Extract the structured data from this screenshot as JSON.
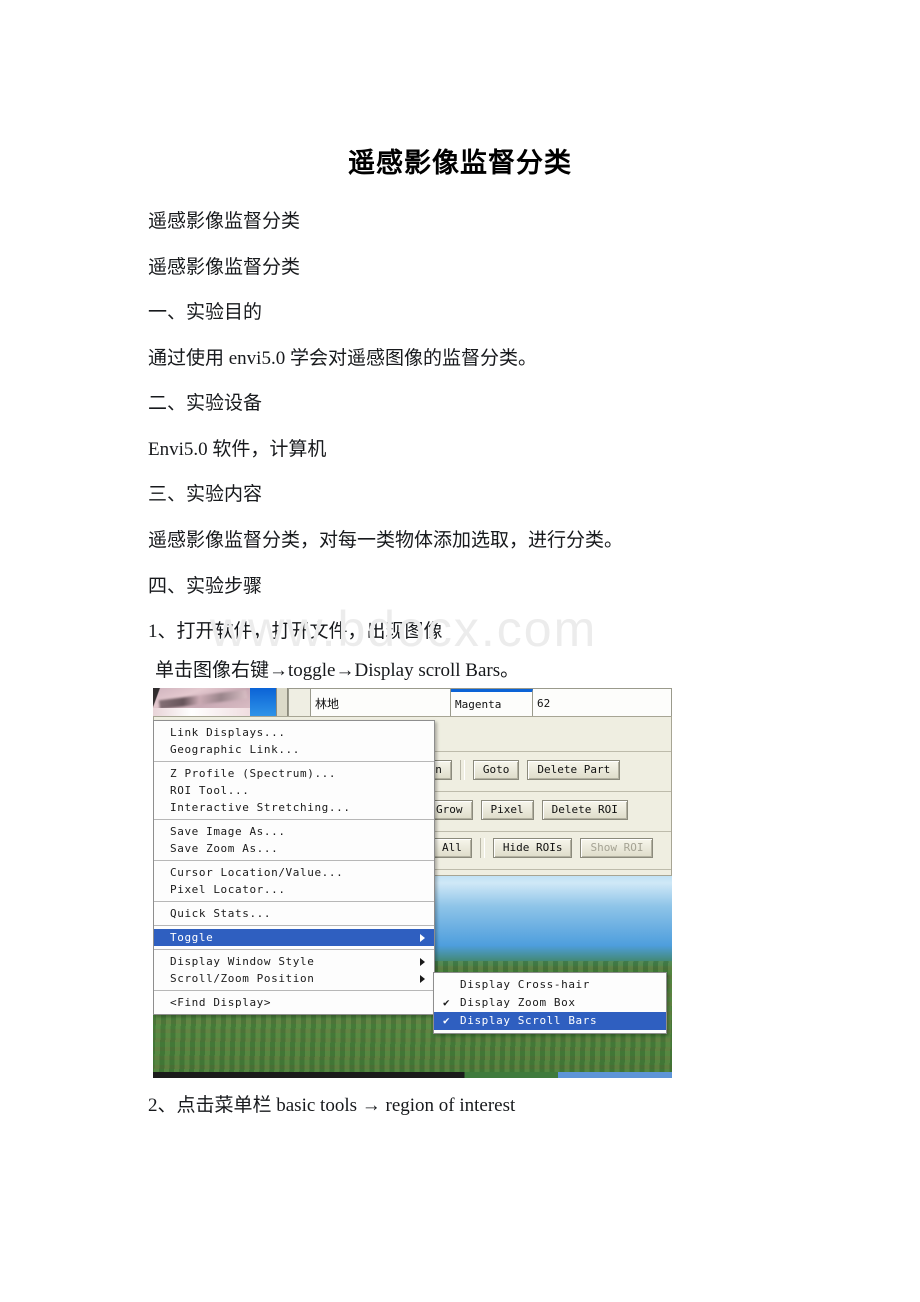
{
  "document": {
    "title": "遥感影像监督分类",
    "watermark": "www.bdocx.com",
    "lines": [
      "遥感影像监督分类",
      "遥感影像监督分类",
      "一、实验目的",
      "通过使用 envi5.0 学会对遥感图像的监督分类。",
      "二、实验设备",
      "Envi5.0 软件，计算机",
      "三、实验内容",
      "遥感影像监督分类，对每一类物体添加选取，进行分类。",
      "四、实验步骤",
      "1、打开软件，打开文件，出现图像",
      "单击图像右键→toggle→Display scroll Bars。",
      "2、点击菜单栏 basic tools → region of interest"
    ]
  },
  "screenshot": {
    "roi_list": {
      "name": "林地",
      "color": "Magenta",
      "count": "62"
    },
    "roi_buttons": [
      "ion",
      "Goto",
      "Delete Part",
      "Grow",
      "Pixel",
      "Delete ROI",
      "All",
      "Hide ROIs",
      "Show ROI"
    ],
    "context_menu": {
      "items": [
        {
          "label": "Link Displays...",
          "type": "item"
        },
        {
          "label": "Geographic Link...",
          "type": "item"
        },
        {
          "label": "",
          "type": "separator"
        },
        {
          "label": "Z Profile (Spectrum)...",
          "type": "item"
        },
        {
          "label": "ROI Tool...",
          "type": "item"
        },
        {
          "label": "Interactive Stretching...",
          "type": "item"
        },
        {
          "label": "",
          "type": "separator"
        },
        {
          "label": "Save Image As...",
          "type": "item"
        },
        {
          "label": "Save Zoom As...",
          "type": "item"
        },
        {
          "label": "",
          "type": "separator"
        },
        {
          "label": "Cursor Location/Value...",
          "type": "item"
        },
        {
          "label": "Pixel Locator...",
          "type": "item"
        },
        {
          "label": "",
          "type": "separator"
        },
        {
          "label": "Quick Stats...",
          "type": "item"
        },
        {
          "label": "",
          "type": "separator"
        },
        {
          "label": "Toggle",
          "type": "submenu",
          "selected": true
        },
        {
          "label": "",
          "type": "separator"
        },
        {
          "label": "Display Window Style",
          "type": "submenu"
        },
        {
          "label": "Scroll/Zoom Position",
          "type": "submenu"
        },
        {
          "label": "",
          "type": "separator"
        },
        {
          "label": "<Find Display>",
          "type": "item"
        }
      ]
    },
    "toggle_submenu": {
      "items": [
        {
          "label": "Display Cross-hair",
          "checked": false,
          "selected": false
        },
        {
          "label": "Display Zoom Box",
          "checked": true,
          "selected": false
        },
        {
          "label": "Display Scroll Bars",
          "checked": true,
          "selected": true
        }
      ],
      "check_glyph": "✔"
    },
    "colors": {
      "menu_highlight": "#2f5fc0",
      "panel_bg": "#efeee1",
      "menu_bg": "#fdfdfd"
    }
  }
}
